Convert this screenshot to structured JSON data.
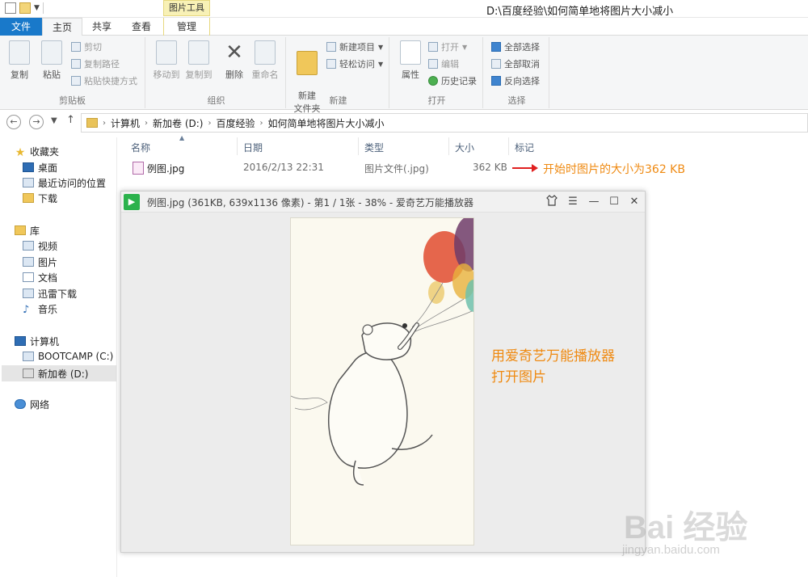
{
  "window": {
    "title": "D:\\百度经验\\如何简单地将图片大小减小",
    "context_tab": "图片工具"
  },
  "tabs": [
    {
      "label": "文件"
    },
    {
      "label": "主页"
    },
    {
      "label": "共享"
    },
    {
      "label": "查看"
    },
    {
      "label": "管理"
    }
  ],
  "ribbon": {
    "clipboard": {
      "label": "剪贴板",
      "copy": "复制",
      "paste": "粘贴",
      "cut": "剪切",
      "copy_path": "复制路径",
      "paste_shortcut": "粘贴快捷方式"
    },
    "organize": {
      "label": "组织",
      "move_to": "移动到",
      "copy_to": "复制到",
      "delete": "删除",
      "rename": "重命名"
    },
    "new": {
      "label": "新建",
      "new_folder": "新建\n文件夹",
      "new_item": "新建项目",
      "easy_access": "轻松访问"
    },
    "open": {
      "label": "打开",
      "properties": "属性",
      "open": "打开",
      "edit": "编辑",
      "history": "历史记录"
    },
    "select": {
      "label": "选择",
      "select_all": "全部选择",
      "select_none": "全部取消",
      "invert": "反向选择"
    }
  },
  "address": {
    "segments": [
      "计算机",
      "新加卷 (D:)",
      "百度经验",
      "如何简单地将图片大小减小"
    ]
  },
  "nav": {
    "favorites": "收藏夹",
    "desktop": "桌面",
    "recent": "最近访问的位置",
    "downloads": "下载",
    "libraries": "库",
    "videos": "视频",
    "pictures": "图片",
    "documents": "文档",
    "thunder": "迅雷下载",
    "music": "音乐",
    "computer": "计算机",
    "bootcamp": "BOOTCAMP (C:)",
    "newvol": "新加卷 (D:)",
    "network": "网络"
  },
  "columns": {
    "name": "名称",
    "date": "日期",
    "type": "类型",
    "size": "大小",
    "tags": "标记"
  },
  "file": {
    "name": "例图.jpg",
    "date": "2016/2/13 22:31",
    "type": "图片文件(.jpg)",
    "size": "362 KB"
  },
  "annotations": {
    "size_note": "开始时图片的大小为362 KB",
    "player_note_1": "用爱奇艺万能播放器",
    "player_note_2": "打开图片"
  },
  "viewer": {
    "title": "例图.jpg (361KB, 639x1136 像素) - 第1 / 1张 - 38% - 爱奇艺万能播放器"
  },
  "watermark": {
    "main": "Bai 经验",
    "sub": "jingyan.baidu.com"
  },
  "colors": {
    "file_tab": "#1979ca",
    "annotation": "#ef8a12",
    "arrow": "#e02020",
    "viewer_logo": "#2bb24c"
  }
}
